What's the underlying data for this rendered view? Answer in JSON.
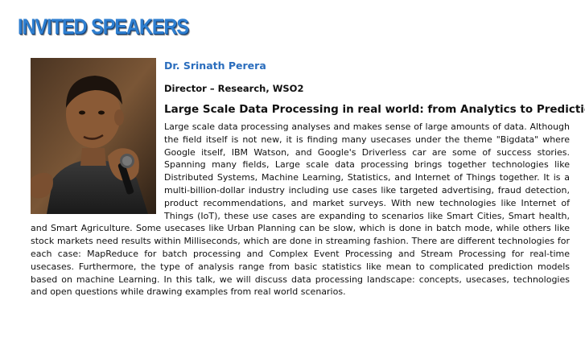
{
  "header": {
    "title": "INVITED SPEAKERS"
  },
  "speaker": {
    "name": "Dr. Srinath Perera",
    "role": "Director – Research, WSO2",
    "photo_alt": "speaker-photo"
  },
  "talk": {
    "title": "Large Scale Data Processing in real world: from Analytics to Predictions",
    "abstract": "Large scale data processing analyses and makes sense of large amounts of data. Although the field itself is not new, it is finding many usecases under the theme \"Bigdata\" where Google itself, IBM Watson, and Google's Driverless car are some of success stories. Spanning many fields, Large scale data processing brings together technologies like Distributed Systems, Machine Learning, Statistics, and Internet of Things together. It is a multi-billion-dollar industry including use cases like targeted advertising, fraud detection, product recommendations, and market surveys. With new technologies like Internet of Things (IoT), these use cases are expanding to scenarios like Smart Cities, Smart health, and Smart Agriculture. Some usecases like Urban Planning can be slow, which is done in batch mode, while others like stock markets need results within Milliseconds, which are done in streaming fashion. There are different technologies for each case: MapReduce for batch processing and Complex Event Processing and Stream Processing for real-time usecases. Furthermore, the type of analysis range from basic statistics like mean to complicated prediction models based on machine Learning. In this talk, we will discuss data processing landscape: concepts, usecases, technologies and open questions while drawing examples from real world scenarios."
  },
  "colors": {
    "heading_blue": "#2f7fd0",
    "name_blue": "#2a6dbd",
    "text": "#111111"
  }
}
